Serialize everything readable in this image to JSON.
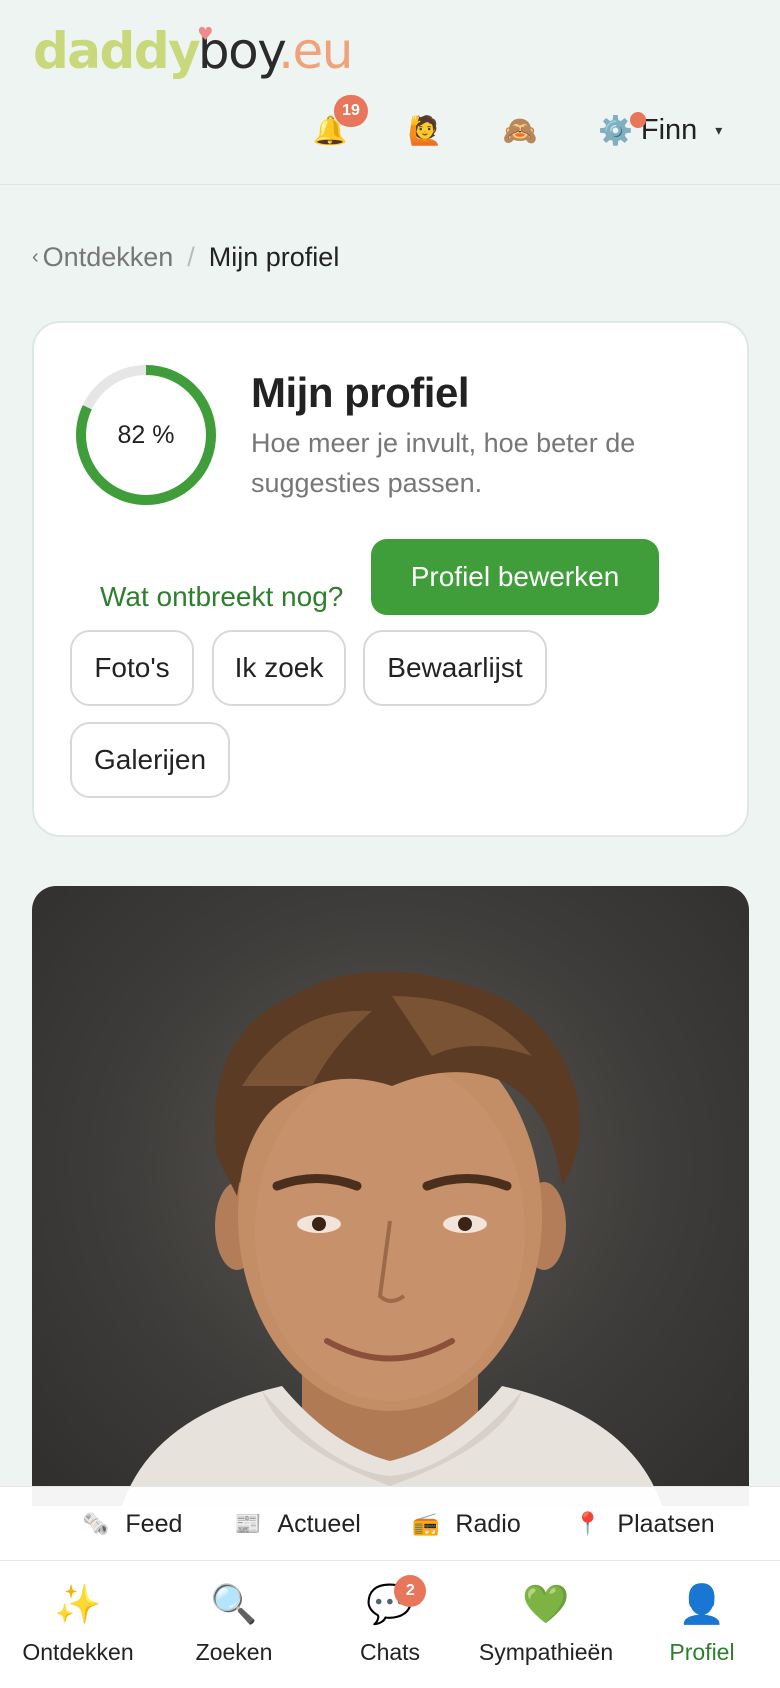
{
  "header": {
    "logo": {
      "part1": "daddy",
      "part2": "boy",
      "part3": ".eu"
    },
    "notifications": {
      "icon": "bell-icon",
      "glyph": "🔔",
      "count": "19"
    },
    "icon2": {
      "icon": "person-raising-hand-icon",
      "glyph": "🙋"
    },
    "icon3": {
      "icon": "see-no-evil-monkey-icon",
      "glyph": "🙈"
    },
    "settings": {
      "icon": "gear-icon",
      "glyph": "⚙️"
    },
    "user_name": "Finn",
    "caret": "▾"
  },
  "breadcrumb": {
    "back_chevron": "‹",
    "back_label": "Ontdekken",
    "separator": "/",
    "current": "Mijn profiel"
  },
  "profile_card": {
    "progress_percent": 82,
    "progress_label": "82 %",
    "title": "Mijn profiel",
    "subtitle": "Hoe meer je invult, hoe beter de suggesties passen.",
    "missing_link": "Wat ontbreekt nog?",
    "edit_button": "Profiel bewerken",
    "chips": [
      "Foto's",
      "Ik zoek",
      "Bewaarlijst",
      "Galerijen"
    ]
  },
  "subnav": [
    {
      "icon": "newspaper-roll-icon",
      "glyph": "🗞️",
      "label": "Feed"
    },
    {
      "icon": "newspaper-icon",
      "glyph": "📰",
      "label": "Actueel"
    },
    {
      "icon": "radio-icon",
      "glyph": "📻",
      "label": "Radio"
    },
    {
      "icon": "pin-icon",
      "glyph": "📍",
      "label": "Plaatsen"
    }
  ],
  "tabs": [
    {
      "icon": "sparkles-icon",
      "glyph": "✨",
      "label": "Ontdekken"
    },
    {
      "icon": "magnifier-icon",
      "glyph": "🔍",
      "label": "Zoeken"
    },
    {
      "icon": "speech-bubble-icon",
      "glyph": "💬",
      "label": "Chats",
      "badge": "2"
    },
    {
      "icon": "green-heart-icon",
      "glyph": "💚",
      "label": "Sympathieën"
    },
    {
      "icon": "person-icon",
      "glyph": "👤",
      "label": "Profiel",
      "active": true
    }
  ],
  "colors": {
    "accent_green": "#3f9d3a",
    "link_green": "#2d7f2d",
    "badge_orange": "#e8765b",
    "background": "#eef4f1"
  }
}
